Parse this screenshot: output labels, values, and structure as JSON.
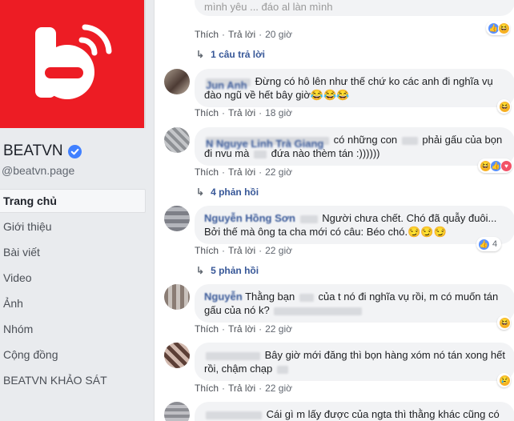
{
  "page": {
    "name": "BEATVN",
    "handle": "@beatvn.page",
    "colors": {
      "brand": "#ed1c24",
      "link": "#385898",
      "verified": "#4080ff"
    }
  },
  "nav": {
    "items": [
      {
        "label": "Trang chủ",
        "active": true
      },
      {
        "label": "Giới thiệu"
      },
      {
        "label": "Bài viết"
      },
      {
        "label": "Video"
      },
      {
        "label": "Ảnh"
      },
      {
        "label": "Nhóm"
      },
      {
        "label": "Cộng đồng"
      },
      {
        "label": "BEATVN KHẢO SÁT"
      }
    ]
  },
  "actions": {
    "like": "Thích",
    "reply": "Trả lời",
    "separator": "·"
  },
  "comments": [
    {
      "text_top": "mình yêu ... đáo al làn mình",
      "time": "20 giờ",
      "replies": "1 câu trả lời",
      "reactions": [
        "like-icon",
        "haha-icon"
      ]
    },
    {
      "author": "Jun Anh",
      "text": "Đừng có hô lên như thế chứ ko các anh đi nghĩa vụ đào ngũ về hết bây giờ😂😂😂",
      "time": "18 giờ",
      "reactions": [
        "haha-icon"
      ]
    },
    {
      "author": "N Nguye Linh Trà Giang",
      "text_a": "có những con",
      "text_b": "phải gấu của bọn đi nvu mà",
      "text_c": "đứa nào thèm tán :))))))",
      "time": "22 giờ",
      "replies": "4 phản hồi",
      "reactions": [
        "haha-icon",
        "like-icon",
        "love-icon"
      ]
    },
    {
      "author": "Nguyễn Hồng Sơn",
      "text": "Người chưa chết. Chó đã quẫy đuôi... Bởi thế mà ông ta cha mới có câu: Béo chó.😏😏😏",
      "time": "22 giờ",
      "replies": "5 phản hồi",
      "reaction_count": "4"
    },
    {
      "author": "Nguyễn",
      "text_a": "Thằng bạn",
      "text_b": "của t nó đi nghĩa vụ rồi, m có muốn tán gấu của nó k?",
      "time": "22 giờ",
      "reactions": [
        "haha-icon"
      ]
    },
    {
      "text_a": "Bây giờ mới đăng thì bọn hàng xóm nó tán xong hết rồi, chậm chạp",
      "time": "22 giờ",
      "reactions": [
        "sad-icon"
      ]
    },
    {
      "text_a": "Cái gì m lấy được của ngta thì thằng khác cũng có thể"
    }
  ]
}
